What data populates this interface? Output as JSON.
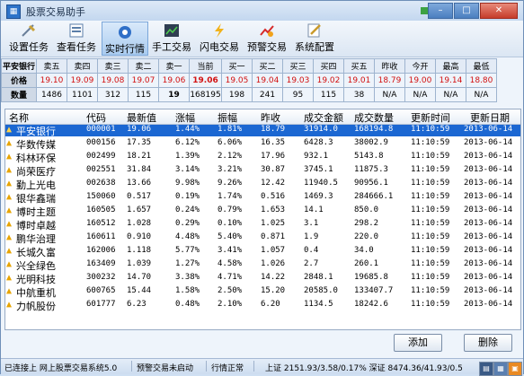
{
  "window": {
    "title": "股票交易助手"
  },
  "toolbar": [
    {
      "label": "设置任务",
      "icon": "settings-task-icon"
    },
    {
      "label": "查看任务",
      "icon": "view-task-icon"
    },
    {
      "label": "实时行情",
      "icon": "realtime-quote-icon",
      "active": true
    },
    {
      "label": "手工交易",
      "icon": "manual-trade-icon"
    },
    {
      "label": "闪电交易",
      "icon": "lightning-trade-icon"
    },
    {
      "label": "预警交易",
      "icon": "alert-trade-icon"
    },
    {
      "label": "系统配置",
      "icon": "system-config-icon"
    }
  ],
  "quote": {
    "stock": "平安银行",
    "headers": [
      "卖五",
      "卖四",
      "卖三",
      "卖二",
      "卖一",
      "当前",
      "买一",
      "买二",
      "买三",
      "买四",
      "买五",
      "昨收",
      "今开",
      "最高",
      "最低"
    ],
    "price_label": "价格",
    "prices": [
      "19.10",
      "19.09",
      "19.08",
      "19.07",
      "19.06",
      "19.06",
      "19.05",
      "19.04",
      "19.03",
      "19.02",
      "19.01",
      "18.79",
      "19.00",
      "19.14",
      "18.80"
    ],
    "qty_label": "数量",
    "qtys": [
      "1486",
      "1101",
      "312",
      "115",
      "19",
      "168195",
      "198",
      "241",
      "95",
      "115",
      "38",
      "N/A",
      "N/A",
      "N/A",
      "N/A"
    ]
  },
  "list": {
    "columns": [
      "名称",
      "代码",
      "最新值",
      "涨幅",
      "振幅",
      "昨收",
      "成交金额",
      "成交数量",
      "更新时间",
      "更新日期"
    ],
    "rows": [
      [
        "平安银行",
        "000001",
        "19.06",
        "1.44%",
        "1.81%",
        "18.79",
        "31914.0",
        "168194.8",
        "11:10:59",
        "2013-06-14"
      ],
      [
        "华数传媒",
        "000156",
        "17.35",
        "6.12%",
        "6.06%",
        "16.35",
        "6428.3",
        "38002.9",
        "11:10:59",
        "2013-06-14"
      ],
      [
        "科林环保",
        "002499",
        "18.21",
        "1.39%",
        "2.12%",
        "17.96",
        "932.1",
        "5143.8",
        "11:10:59",
        "2013-06-14"
      ],
      [
        "尚荣医疗",
        "002551",
        "31.84",
        "3.14%",
        "3.21%",
        "30.87",
        "3745.1",
        "11875.3",
        "11:10:59",
        "2013-06-14"
      ],
      [
        "勤上光电",
        "002638",
        "13.66",
        "9.98%",
        "9.26%",
        "12.42",
        "11940.5",
        "90956.1",
        "11:10:59",
        "2013-06-14"
      ],
      [
        "银华鑫瑞",
        "150060",
        "0.517",
        "0.19%",
        "1.74%",
        "0.516",
        "1469.3",
        "284666.1",
        "11:10:59",
        "2013-06-14"
      ],
      [
        "博时主题",
        "160505",
        "1.657",
        "0.24%",
        "0.79%",
        "1.653",
        "14.1",
        "850.0",
        "11:10:59",
        "2013-06-14"
      ],
      [
        "博时卓越",
        "160512",
        "1.028",
        "0.29%",
        "0.10%",
        "1.025",
        "3.1",
        "298.2",
        "11:10:59",
        "2013-06-14"
      ],
      [
        "鹏华治理",
        "160611",
        "0.910",
        "4.48%",
        "5.40%",
        "0.871",
        "1.9",
        "220.0",
        "11:10:59",
        "2013-06-14"
      ],
      [
        "长城久富",
        "162006",
        "1.118",
        "5.77%",
        "3.41%",
        "1.057",
        "0.4",
        "34.0",
        "11:10:59",
        "2013-06-14"
      ],
      [
        "兴全绿色",
        "163409",
        "1.039",
        "1.27%",
        "4.58%",
        "1.026",
        "2.7",
        "260.1",
        "11:10:59",
        "2013-06-14"
      ],
      [
        "光明科技",
        "300232",
        "14.70",
        "3.38%",
        "4.71%",
        "14.22",
        "2848.1",
        "19685.8",
        "11:10:59",
        "2013-06-14"
      ],
      [
        "中航重机",
        "600765",
        "15.44",
        "1.58%",
        "2.50%",
        "15.20",
        "20585.0",
        "133407.7",
        "11:10:59",
        "2013-06-14"
      ],
      [
        "力帆股份",
        "601777",
        "6.23",
        "0.48%",
        "2.10%",
        "6.20",
        "1134.5",
        "18242.6",
        "11:10:59",
        "2013-06-14"
      ]
    ]
  },
  "buttons": {
    "add": "添加",
    "delete": "删除"
  },
  "status": {
    "conn": "已连接上 网上股票交易系统5.0",
    "alert": "预警交易未启动",
    "market": "行情正常",
    "index": "上证 2151.93/3.58/0.17% 深证 8474.36/41.93/0.5"
  },
  "colors": {
    "accent": "#1b67d2",
    "up": "#d21010"
  }
}
